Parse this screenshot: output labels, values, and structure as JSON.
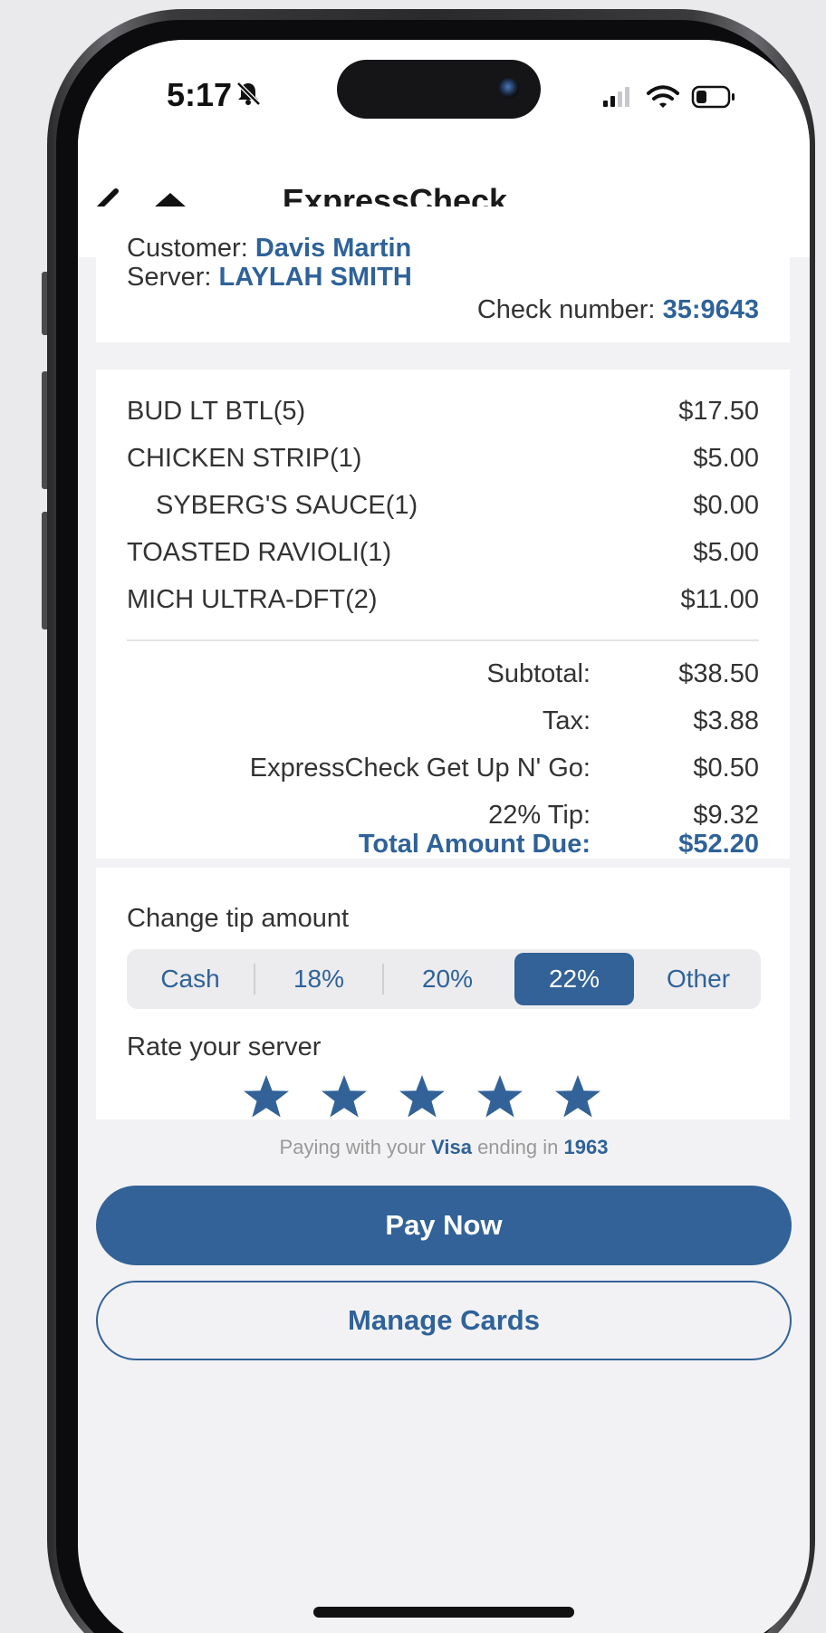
{
  "status_bar": {
    "time": "5:17",
    "icons": [
      "silent-bell-icon",
      "signal-icon",
      "wifi-icon",
      "battery-icon"
    ]
  },
  "nav": {
    "title": "ExpressCheck",
    "back_icon": "chevron-left-icon",
    "home_icon": "home-icon"
  },
  "check_info": {
    "customer_label": "Customer:",
    "customer_name": "Davis Martin",
    "server_label": "Server:",
    "server_name": "LAYLAH SMITH",
    "check_label": "Check number:",
    "check_number": "35:9643"
  },
  "items": [
    {
      "name": "BUD LT BTL(5)",
      "price": "$17.50"
    },
    {
      "name": "CHICKEN STRIP(1)",
      "price": "$5.00"
    },
    {
      "name": "SYBERG'S SAUCE(1)",
      "price": "$0.00"
    },
    {
      "name": "TOASTED RAVIOLI(1)",
      "price": "$5.00"
    },
    {
      "name": "MICH ULTRA-DFT(2)",
      "price": "$11.00"
    }
  ],
  "totals": [
    {
      "label": "Subtotal:",
      "value": "$38.50"
    },
    {
      "label": "Tax:",
      "value": "$3.88"
    },
    {
      "label": "ExpressCheck Get Up N' Go:",
      "value": "$0.50"
    },
    {
      "label": "22% Tip:",
      "value": "$9.32"
    }
  ],
  "total_due": {
    "label": "Total Amount Due:",
    "value": "$52.20"
  },
  "tip": {
    "label": "Change tip amount",
    "options": [
      "Cash",
      "18%",
      "20%",
      "22%",
      "Other"
    ],
    "selected": "22%"
  },
  "rating": {
    "label": "Rate your server",
    "stars": 5,
    "max": 5
  },
  "payment": {
    "prefix": "Paying with your",
    "card_brand": "Visa",
    "middle": "ending in",
    "last4": "1963"
  },
  "buttons": {
    "pay_now": "Pay Now",
    "manage_cards": "Manage Cards"
  },
  "colors": {
    "accent": "#326297",
    "background": "#f2f2f4"
  }
}
